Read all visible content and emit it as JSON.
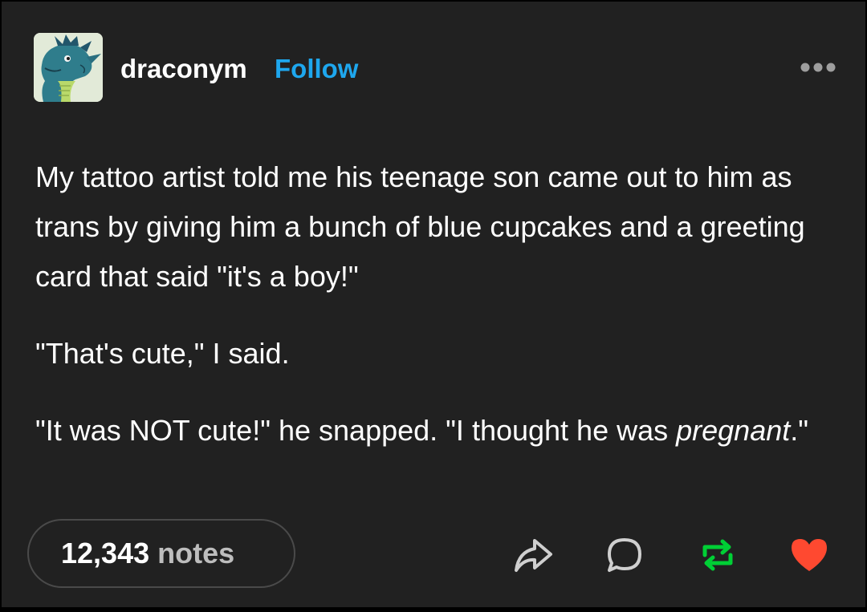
{
  "post": {
    "username": "draconym",
    "follow_label": "Follow",
    "avatar_icon": "dragon-avatar-icon",
    "paragraphs": [
      "My tattoo artist told me his teenage son came out to him as trans by giving him a bunch of blue cupcakes and a greeting card that said \"it's a boy!\"",
      "\"That's cute,\" I said.",
      "\"It was NOT cute!\" he snapped. \"I thought he was "
    ],
    "emphasis_word": "pregnant",
    "closing_punctuation": ".\"",
    "notes_count": "12,343",
    "notes_label": "notes"
  },
  "actions": {
    "share_icon": "share-icon",
    "reply_icon": "reply-icon",
    "reblog_icon": "reblog-icon",
    "like_icon": "heart-icon"
  },
  "colors": {
    "background": "#212121",
    "follow": "#1ea7ee",
    "reblog": "#00cf35",
    "like": "#ff4930",
    "text": "#ffffff"
  }
}
